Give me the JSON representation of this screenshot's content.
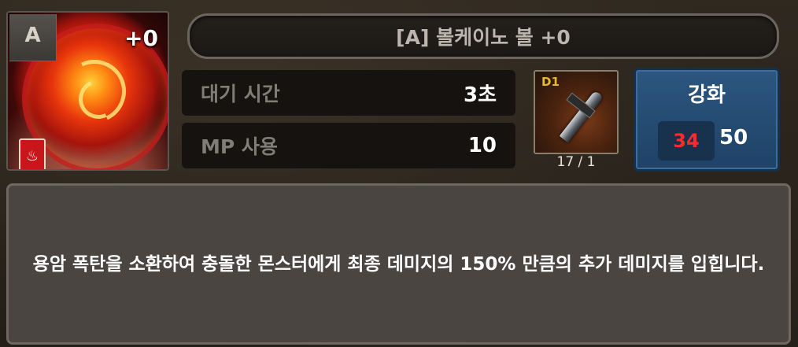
{
  "skill": {
    "grade": "A",
    "enhance_level": "+0",
    "element_icon": "fire-element-icon",
    "name": "[A] 볼케이노 볼 +0"
  },
  "stats": {
    "cooldown_label": "대기 시간",
    "cooldown_value": "3초",
    "mp_label": "MP 사용",
    "mp_value": "10"
  },
  "weapon": {
    "tag": "D1",
    "icon": "sword-icon",
    "count": "17 / 1"
  },
  "upgrade": {
    "label": "강화",
    "cost": "34",
    "owned": "50",
    "cost_color": "#ff2a2a"
  },
  "description": "용암 폭탄을 소환하여 충돌한 몬스터에게 최종 데미지의 150% 만큼의 추가 데미지를 입힙니다.",
  "colors": {
    "upgrade_button": "#2c5680",
    "weapon_tag": "#e4b935",
    "element_badge": "#c8161b"
  }
}
